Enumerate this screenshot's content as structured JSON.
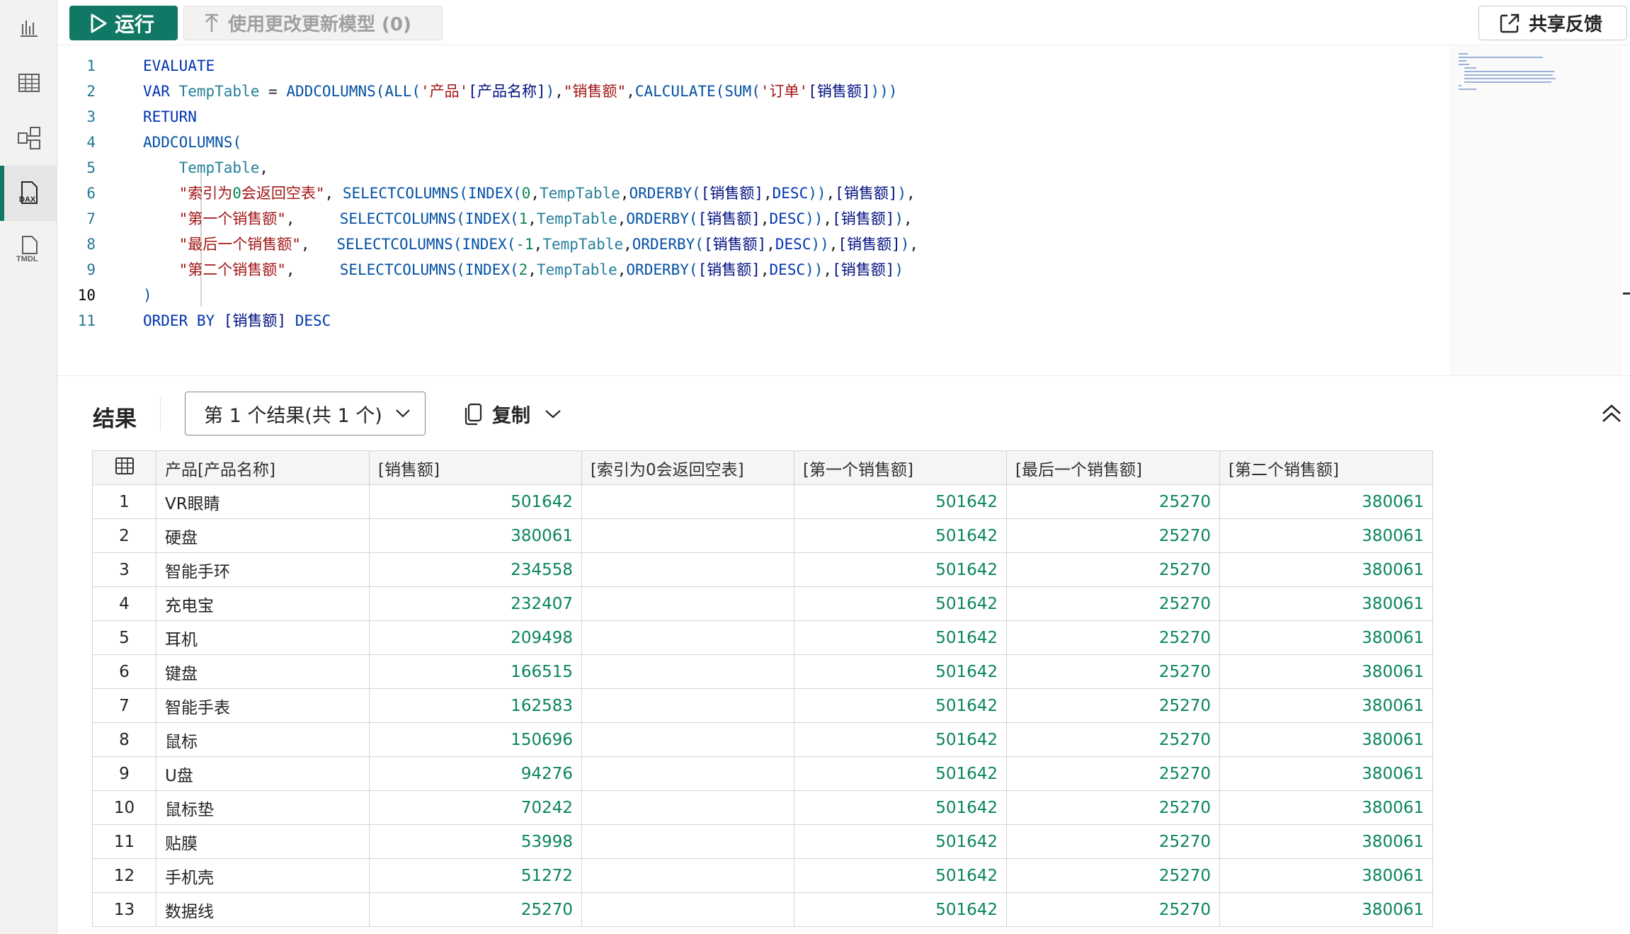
{
  "toolbar": {
    "run_label": "运行",
    "update_label": "使用更改更新模型 (0)",
    "feedback_label": "共享反馈"
  },
  "sidebar": {
    "items": [
      {
        "icon": "report-chart-icon"
      },
      {
        "icon": "table-view-icon"
      },
      {
        "icon": "model-view-icon"
      },
      {
        "icon": "dax-query-icon",
        "label": "DAX"
      },
      {
        "icon": "tmdl-view-icon",
        "label": "TMDL"
      }
    ]
  },
  "editor": {
    "line_numbers": [
      "1",
      "2",
      "3",
      "4",
      "5",
      "6",
      "7",
      "8",
      "9",
      "10",
      "11"
    ],
    "current_line": 10
  },
  "results": {
    "title": "结果",
    "selector_label": "第 1 个结果(共 1 个)",
    "copy_label": "复制",
    "columns": [
      "产品[产品名称]",
      "[销售额]",
      "[索引为0会返回空表]",
      "[第一个销售额]",
      "[最后一个销售额]",
      "[第二个销售额]"
    ],
    "rows": [
      [
        "1",
        "VR眼睛",
        "501642",
        "",
        "501642",
        "25270",
        "380061"
      ],
      [
        "2",
        "硬盘",
        "380061",
        "",
        "501642",
        "25270",
        "380061"
      ],
      [
        "3",
        "智能手环",
        "234558",
        "",
        "501642",
        "25270",
        "380061"
      ],
      [
        "4",
        "充电宝",
        "232407",
        "",
        "501642",
        "25270",
        "380061"
      ],
      [
        "5",
        "耳机",
        "209498",
        "",
        "501642",
        "25270",
        "380061"
      ],
      [
        "6",
        "键盘",
        "166515",
        "",
        "501642",
        "25270",
        "380061"
      ],
      [
        "7",
        "智能手表",
        "162583",
        "",
        "501642",
        "25270",
        "380061"
      ],
      [
        "8",
        "鼠标",
        "150696",
        "",
        "501642",
        "25270",
        "380061"
      ],
      [
        "9",
        "U盘",
        "94276",
        "",
        "501642",
        "25270",
        "380061"
      ],
      [
        "10",
        "鼠标垫",
        "70242",
        "",
        "501642",
        "25270",
        "380061"
      ],
      [
        "11",
        "贴膜",
        "53998",
        "",
        "501642",
        "25270",
        "380061"
      ],
      [
        "12",
        "手机壳",
        "51272",
        "",
        "501642",
        "25270",
        "380061"
      ],
      [
        "13",
        "数据线",
        "25270",
        "",
        "501642",
        "25270",
        "380061"
      ]
    ]
  },
  "code_lines": [
    [
      {
        "t": "EVALUATE",
        "c": "kw"
      }
    ],
    [
      {
        "t": "VAR ",
        "c": "kw"
      },
      {
        "t": "TempTable",
        "c": "var"
      },
      {
        "t": " = ",
        "c": "id"
      },
      {
        "t": "ADDCOLUMNS",
        "c": "fn"
      },
      {
        "t": "(",
        "c": "fn"
      },
      {
        "t": "ALL",
        "c": "fn"
      },
      {
        "t": "(",
        "c": "fn"
      },
      {
        "t": "'产品'",
        "c": "str"
      },
      {
        "t": "[产品名称]",
        "c": "col"
      },
      {
        "t": ")",
        "c": "fn"
      },
      {
        "t": ",",
        "c": "id"
      },
      {
        "t": "\"销售额\"",
        "c": "str"
      },
      {
        "t": ",",
        "c": "id"
      },
      {
        "t": "CALCULATE",
        "c": "fn"
      },
      {
        "t": "(",
        "c": "fn"
      },
      {
        "t": "SUM",
        "c": "fn"
      },
      {
        "t": "(",
        "c": "fn"
      },
      {
        "t": "'订单'",
        "c": "str"
      },
      {
        "t": "[销售额]",
        "c": "col"
      },
      {
        "t": ")))",
        "c": "fn"
      }
    ],
    [
      {
        "t": "RETURN",
        "c": "kw"
      }
    ],
    [
      {
        "t": "ADDCOLUMNS",
        "c": "fn"
      },
      {
        "t": "(",
        "c": "fn"
      }
    ],
    [
      {
        "t": "    ",
        "c": "id"
      },
      {
        "t": "TempTable",
        "c": "var"
      },
      {
        "t": ",",
        "c": "id"
      }
    ],
    [
      {
        "t": "    ",
        "c": "id"
      },
      {
        "t": "\"索引为",
        "c": "str"
      },
      {
        "t": "0",
        "c": "num"
      },
      {
        "t": "会返回空表\"",
        "c": "str"
      },
      {
        "t": ", ",
        "c": "id"
      },
      {
        "t": "SELECTCOLUMNS",
        "c": "fn"
      },
      {
        "t": "(",
        "c": "fn"
      },
      {
        "t": "INDEX",
        "c": "fn"
      },
      {
        "t": "(",
        "c": "fn"
      },
      {
        "t": "0",
        "c": "num"
      },
      {
        "t": ",",
        "c": "id"
      },
      {
        "t": "TempTable",
        "c": "var"
      },
      {
        "t": ",",
        "c": "id"
      },
      {
        "t": "ORDERBY",
        "c": "fn"
      },
      {
        "t": "(",
        "c": "fn"
      },
      {
        "t": "[销售额]",
        "c": "col"
      },
      {
        "t": ",",
        "c": "id"
      },
      {
        "t": "DESC",
        "c": "kw"
      },
      {
        "t": "))",
        "c": "fn"
      },
      {
        "t": ",",
        "c": "id"
      },
      {
        "t": "[销售额]",
        "c": "col"
      },
      {
        "t": ")",
        "c": "fn"
      },
      {
        "t": ",",
        "c": "id"
      }
    ],
    [
      {
        "t": "    ",
        "c": "id"
      },
      {
        "t": "\"第一个销售额\"",
        "c": "str"
      },
      {
        "t": ",     ",
        "c": "id"
      },
      {
        "t": "SELECTCOLUMNS",
        "c": "fn"
      },
      {
        "t": "(",
        "c": "fn"
      },
      {
        "t": "INDEX",
        "c": "fn"
      },
      {
        "t": "(",
        "c": "fn"
      },
      {
        "t": "1",
        "c": "num"
      },
      {
        "t": ",",
        "c": "id"
      },
      {
        "t": "TempTable",
        "c": "var"
      },
      {
        "t": ",",
        "c": "id"
      },
      {
        "t": "ORDERBY",
        "c": "fn"
      },
      {
        "t": "(",
        "c": "fn"
      },
      {
        "t": "[销售额]",
        "c": "col"
      },
      {
        "t": ",",
        "c": "id"
      },
      {
        "t": "DESC",
        "c": "kw"
      },
      {
        "t": "))",
        "c": "fn"
      },
      {
        "t": ",",
        "c": "id"
      },
      {
        "t": "[销售额]",
        "c": "col"
      },
      {
        "t": ")",
        "c": "fn"
      },
      {
        "t": ",",
        "c": "id"
      }
    ],
    [
      {
        "t": "    ",
        "c": "id"
      },
      {
        "t": "\"最后一个销售额\"",
        "c": "str"
      },
      {
        "t": ",   ",
        "c": "id"
      },
      {
        "t": "SELECTCOLUMNS",
        "c": "fn"
      },
      {
        "t": "(",
        "c": "fn"
      },
      {
        "t": "INDEX",
        "c": "fn"
      },
      {
        "t": "(",
        "c": "fn"
      },
      {
        "t": "-1",
        "c": "num"
      },
      {
        "t": ",",
        "c": "id"
      },
      {
        "t": "TempTable",
        "c": "var"
      },
      {
        "t": ",",
        "c": "id"
      },
      {
        "t": "ORDERBY",
        "c": "fn"
      },
      {
        "t": "(",
        "c": "fn"
      },
      {
        "t": "[销售额]",
        "c": "col"
      },
      {
        "t": ",",
        "c": "id"
      },
      {
        "t": "DESC",
        "c": "kw"
      },
      {
        "t": "))",
        "c": "fn"
      },
      {
        "t": ",",
        "c": "id"
      },
      {
        "t": "[销售额]",
        "c": "col"
      },
      {
        "t": ")",
        "c": "fn"
      },
      {
        "t": ",",
        "c": "id"
      }
    ],
    [
      {
        "t": "    ",
        "c": "id"
      },
      {
        "t": "\"第二个销售额\"",
        "c": "str"
      },
      {
        "t": ",     ",
        "c": "id"
      },
      {
        "t": "SELECTCOLUMNS",
        "c": "fn"
      },
      {
        "t": "(",
        "c": "fn"
      },
      {
        "t": "INDEX",
        "c": "fn"
      },
      {
        "t": "(",
        "c": "fn"
      },
      {
        "t": "2",
        "c": "num"
      },
      {
        "t": ",",
        "c": "id"
      },
      {
        "t": "TempTable",
        "c": "var"
      },
      {
        "t": ",",
        "c": "id"
      },
      {
        "t": "ORDERBY",
        "c": "fn"
      },
      {
        "t": "(",
        "c": "fn"
      },
      {
        "t": "[销售额]",
        "c": "col"
      },
      {
        "t": ",",
        "c": "id"
      },
      {
        "t": "DESC",
        "c": "kw"
      },
      {
        "t": "))",
        "c": "fn"
      },
      {
        "t": ",",
        "c": "id"
      },
      {
        "t": "[销售额]",
        "c": "col"
      },
      {
        "t": ")",
        "c": "fn"
      }
    ],
    [
      {
        "t": ")",
        "c": "fn"
      }
    ],
    [
      {
        "t": "ORDER BY ",
        "c": "kw"
      },
      {
        "t": "[销售额]",
        "c": "col"
      },
      {
        "t": " DESC",
        "c": "kw"
      }
    ]
  ],
  "colors": {
    "accent": "#117865",
    "keyword": "#0033b3",
    "string": "#a31515",
    "number": "#098658"
  }
}
